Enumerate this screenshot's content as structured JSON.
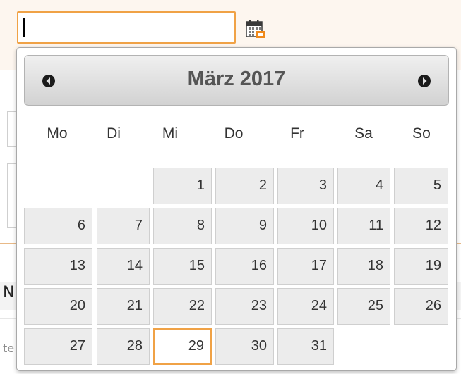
{
  "datepicker": {
    "month_label": "März 2017",
    "weekdays": [
      "Mo",
      "Di",
      "Mi",
      "Do",
      "Fr",
      "Sa",
      "So"
    ],
    "today": "29",
    "weeks": [
      [
        "",
        "",
        "1",
        "2",
        "3",
        "4",
        "5"
      ],
      [
        "6",
        "7",
        "8",
        "9",
        "10",
        "11",
        "12"
      ],
      [
        "13",
        "14",
        "15",
        "16",
        "17",
        "18",
        "19"
      ],
      [
        "20",
        "21",
        "22",
        "23",
        "24",
        "25",
        "26"
      ],
      [
        "27",
        "28",
        "29",
        "30",
        "31",
        "",
        ""
      ]
    ],
    "prev_icon": "chevron-left-icon",
    "next_icon": "chevron-right-icon"
  },
  "date_input": {
    "value": ""
  },
  "background": {
    "fragment_n": "N",
    "fragment_te": "te"
  },
  "colors": {
    "accent": "#f0a246",
    "cell_bg": "#ececec",
    "header_text": "#555555"
  }
}
